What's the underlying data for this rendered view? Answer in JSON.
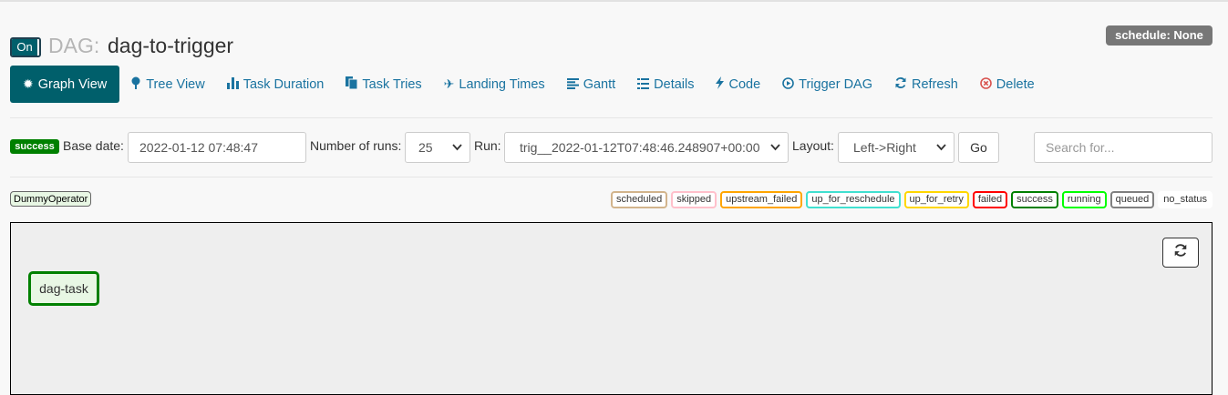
{
  "header": {
    "toggle_label": "On",
    "dag_prefix": "DAG:",
    "dag_id": "dag-to-trigger",
    "schedule_badge": "schedule: None"
  },
  "nav": {
    "items": [
      {
        "label": "Graph View",
        "icon": "sun-icon"
      },
      {
        "label": "Tree View",
        "icon": "tree-icon"
      },
      {
        "label": "Task Duration",
        "icon": "bar-chart-icon"
      },
      {
        "label": "Task Tries",
        "icon": "files-icon"
      },
      {
        "label": "Landing Times",
        "icon": "plane-icon"
      },
      {
        "label": "Gantt",
        "icon": "align-left-icon"
      },
      {
        "label": "Details",
        "icon": "list-icon"
      },
      {
        "label": "Code",
        "icon": "bolt-icon"
      },
      {
        "label": "Trigger DAG",
        "icon": "play-circle-icon"
      },
      {
        "label": "Refresh",
        "icon": "refresh-icon"
      },
      {
        "label": "Delete",
        "icon": "remove-circle-icon"
      }
    ]
  },
  "form": {
    "status_badge": "success",
    "base_date_label": "Base date:",
    "base_date_value": "2022-01-12 07:48:47",
    "num_runs_label": "Number of runs:",
    "num_runs_value": "25",
    "run_label": "Run:",
    "run_value": "trig__2022-01-12T07:48:46.248907+00:00",
    "layout_label": "Layout:",
    "layout_value": "Left->Right",
    "go_label": "Go",
    "search_placeholder": "Search for..."
  },
  "legend": {
    "operator": "DummyOperator",
    "states": [
      {
        "label": "scheduled",
        "color": "#d2b48c"
      },
      {
        "label": "skipped",
        "color": "#ffc0cb"
      },
      {
        "label": "upstream_failed",
        "color": "#ffa500"
      },
      {
        "label": "up_for_reschedule",
        "color": "#40e0d0"
      },
      {
        "label": "up_for_retry",
        "color": "#ffd700"
      },
      {
        "label": "failed",
        "color": "#ff0000"
      },
      {
        "label": "success",
        "color": "#008000"
      },
      {
        "label": "running",
        "color": "#00ff00"
      },
      {
        "label": "queued",
        "color": "#808080"
      },
      {
        "label": "no_status",
        "color": "#ffffff"
      }
    ]
  },
  "graph": {
    "task_label": "dag-task",
    "task_state_color": "#008000"
  }
}
